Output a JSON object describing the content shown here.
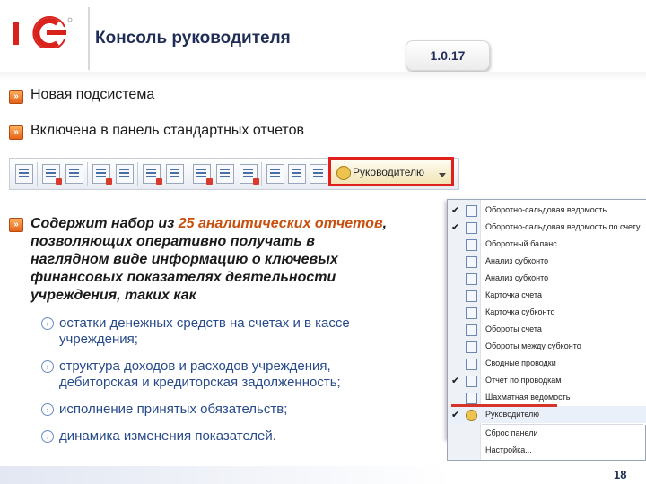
{
  "header": {
    "title": "Консоль руководителя",
    "version": "1.0.17"
  },
  "bullets": [
    "Новая подсистема",
    "Включена в панель стандартных отчетов"
  ],
  "toolbar": {
    "highlighted_button_label": "Руководителю"
  },
  "description": {
    "line1_prefix": "Содержит набор из ",
    "line1_highlight": "25 аналитических отчетов",
    "line1_suffix": ",",
    "line2": "позволяющих оперативно получать в",
    "line3": "наглядном виде информацию о ключевых",
    "line4": "финансовых показателях деятельности",
    "line5": "учреждения, таких как"
  },
  "sub_items": [
    {
      "lines": [
        "остатки денежных средств на счетах и в кассе",
        "учреждения;"
      ]
    },
    {
      "lines": [
        "структура доходов и расходов учреждения,",
        "дебиторская и кредиторская задолженность;"
      ]
    },
    {
      "lines": [
        "исполнение принятых обязательств;"
      ]
    },
    {
      "lines": [
        "динамика изменения показателей."
      ]
    }
  ],
  "menu": {
    "items": [
      {
        "label": "Оборотно-сальдовая ведомость",
        "checked": true
      },
      {
        "label": "Оборотно-сальдовая ведомость по счету",
        "checked": true
      },
      {
        "label": "Оборотный баланс",
        "checked": false
      },
      {
        "label": "Анализ субконто",
        "checked": false
      },
      {
        "label": "Анализ субконто",
        "checked": false
      },
      {
        "label": "Карточка счета",
        "checked": false
      },
      {
        "label": "Карточка субконто",
        "checked": false
      },
      {
        "label": "Обороты счета",
        "checked": false
      },
      {
        "label": "Обороты между субконто",
        "checked": false
      },
      {
        "label": "Сводные проводки",
        "checked": false
      },
      {
        "label": "Отчет по проводкам",
        "checked": true
      },
      {
        "label": "Шахматная ведомость",
        "checked": false
      },
      {
        "label": "Руководителю",
        "checked": true
      }
    ],
    "footer_items": [
      {
        "label": "Сброс панели"
      },
      {
        "label": "Настройка..."
      }
    ]
  },
  "page_number": "18",
  "colors": {
    "accent_orange": "#c8500f",
    "sub_text_blue": "#274a8a",
    "highlight_red": "#e0201d",
    "title_navy": "#1f2d57"
  }
}
